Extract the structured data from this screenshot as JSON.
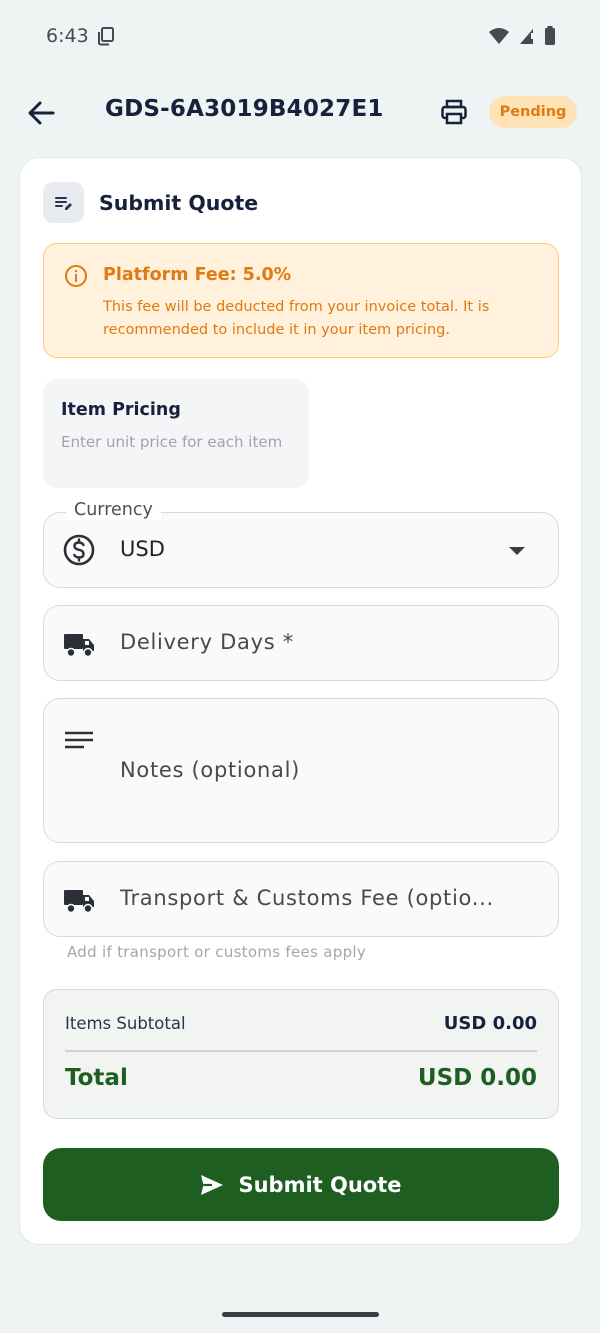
{
  "status_bar": {
    "time": "6:43"
  },
  "app_bar": {
    "title": "GDS-6A3019B4027E1",
    "status_badge": "Pending",
    "badge_color": "#ffe2b5",
    "badge_text_color": "#e07a12"
  },
  "card": {
    "title": "Submit Quote",
    "platform_fee": {
      "title": "Platform Fee: 5.0%",
      "description": "This fee will be deducted from your invoice total. It is recommended to include it in your item pricing."
    },
    "item_pricing": {
      "title": "Item Pricing",
      "subtitle": "Enter unit price for each item"
    },
    "currency_field": {
      "label": "Currency",
      "value": "USD",
      "icon": "dollar-circle-icon"
    },
    "delivery_field": {
      "placeholder": "Delivery Days *",
      "icon": "truck-icon"
    },
    "notes_field": {
      "placeholder": "Notes (optional)",
      "icon": "notes-lines-icon"
    },
    "transport_field": {
      "placeholder": "Transport & Customs Fee (optio...",
      "helper": "Add if transport or customs fees apply",
      "icon": "truck-icon"
    },
    "summary": {
      "subtotal_label": "Items Subtotal",
      "subtotal_value": "USD 0.00",
      "total_label": "Total",
      "total_value": "USD 0.00"
    },
    "submit_button": {
      "label": "Submit Quote",
      "color": "#1e5e20"
    }
  }
}
